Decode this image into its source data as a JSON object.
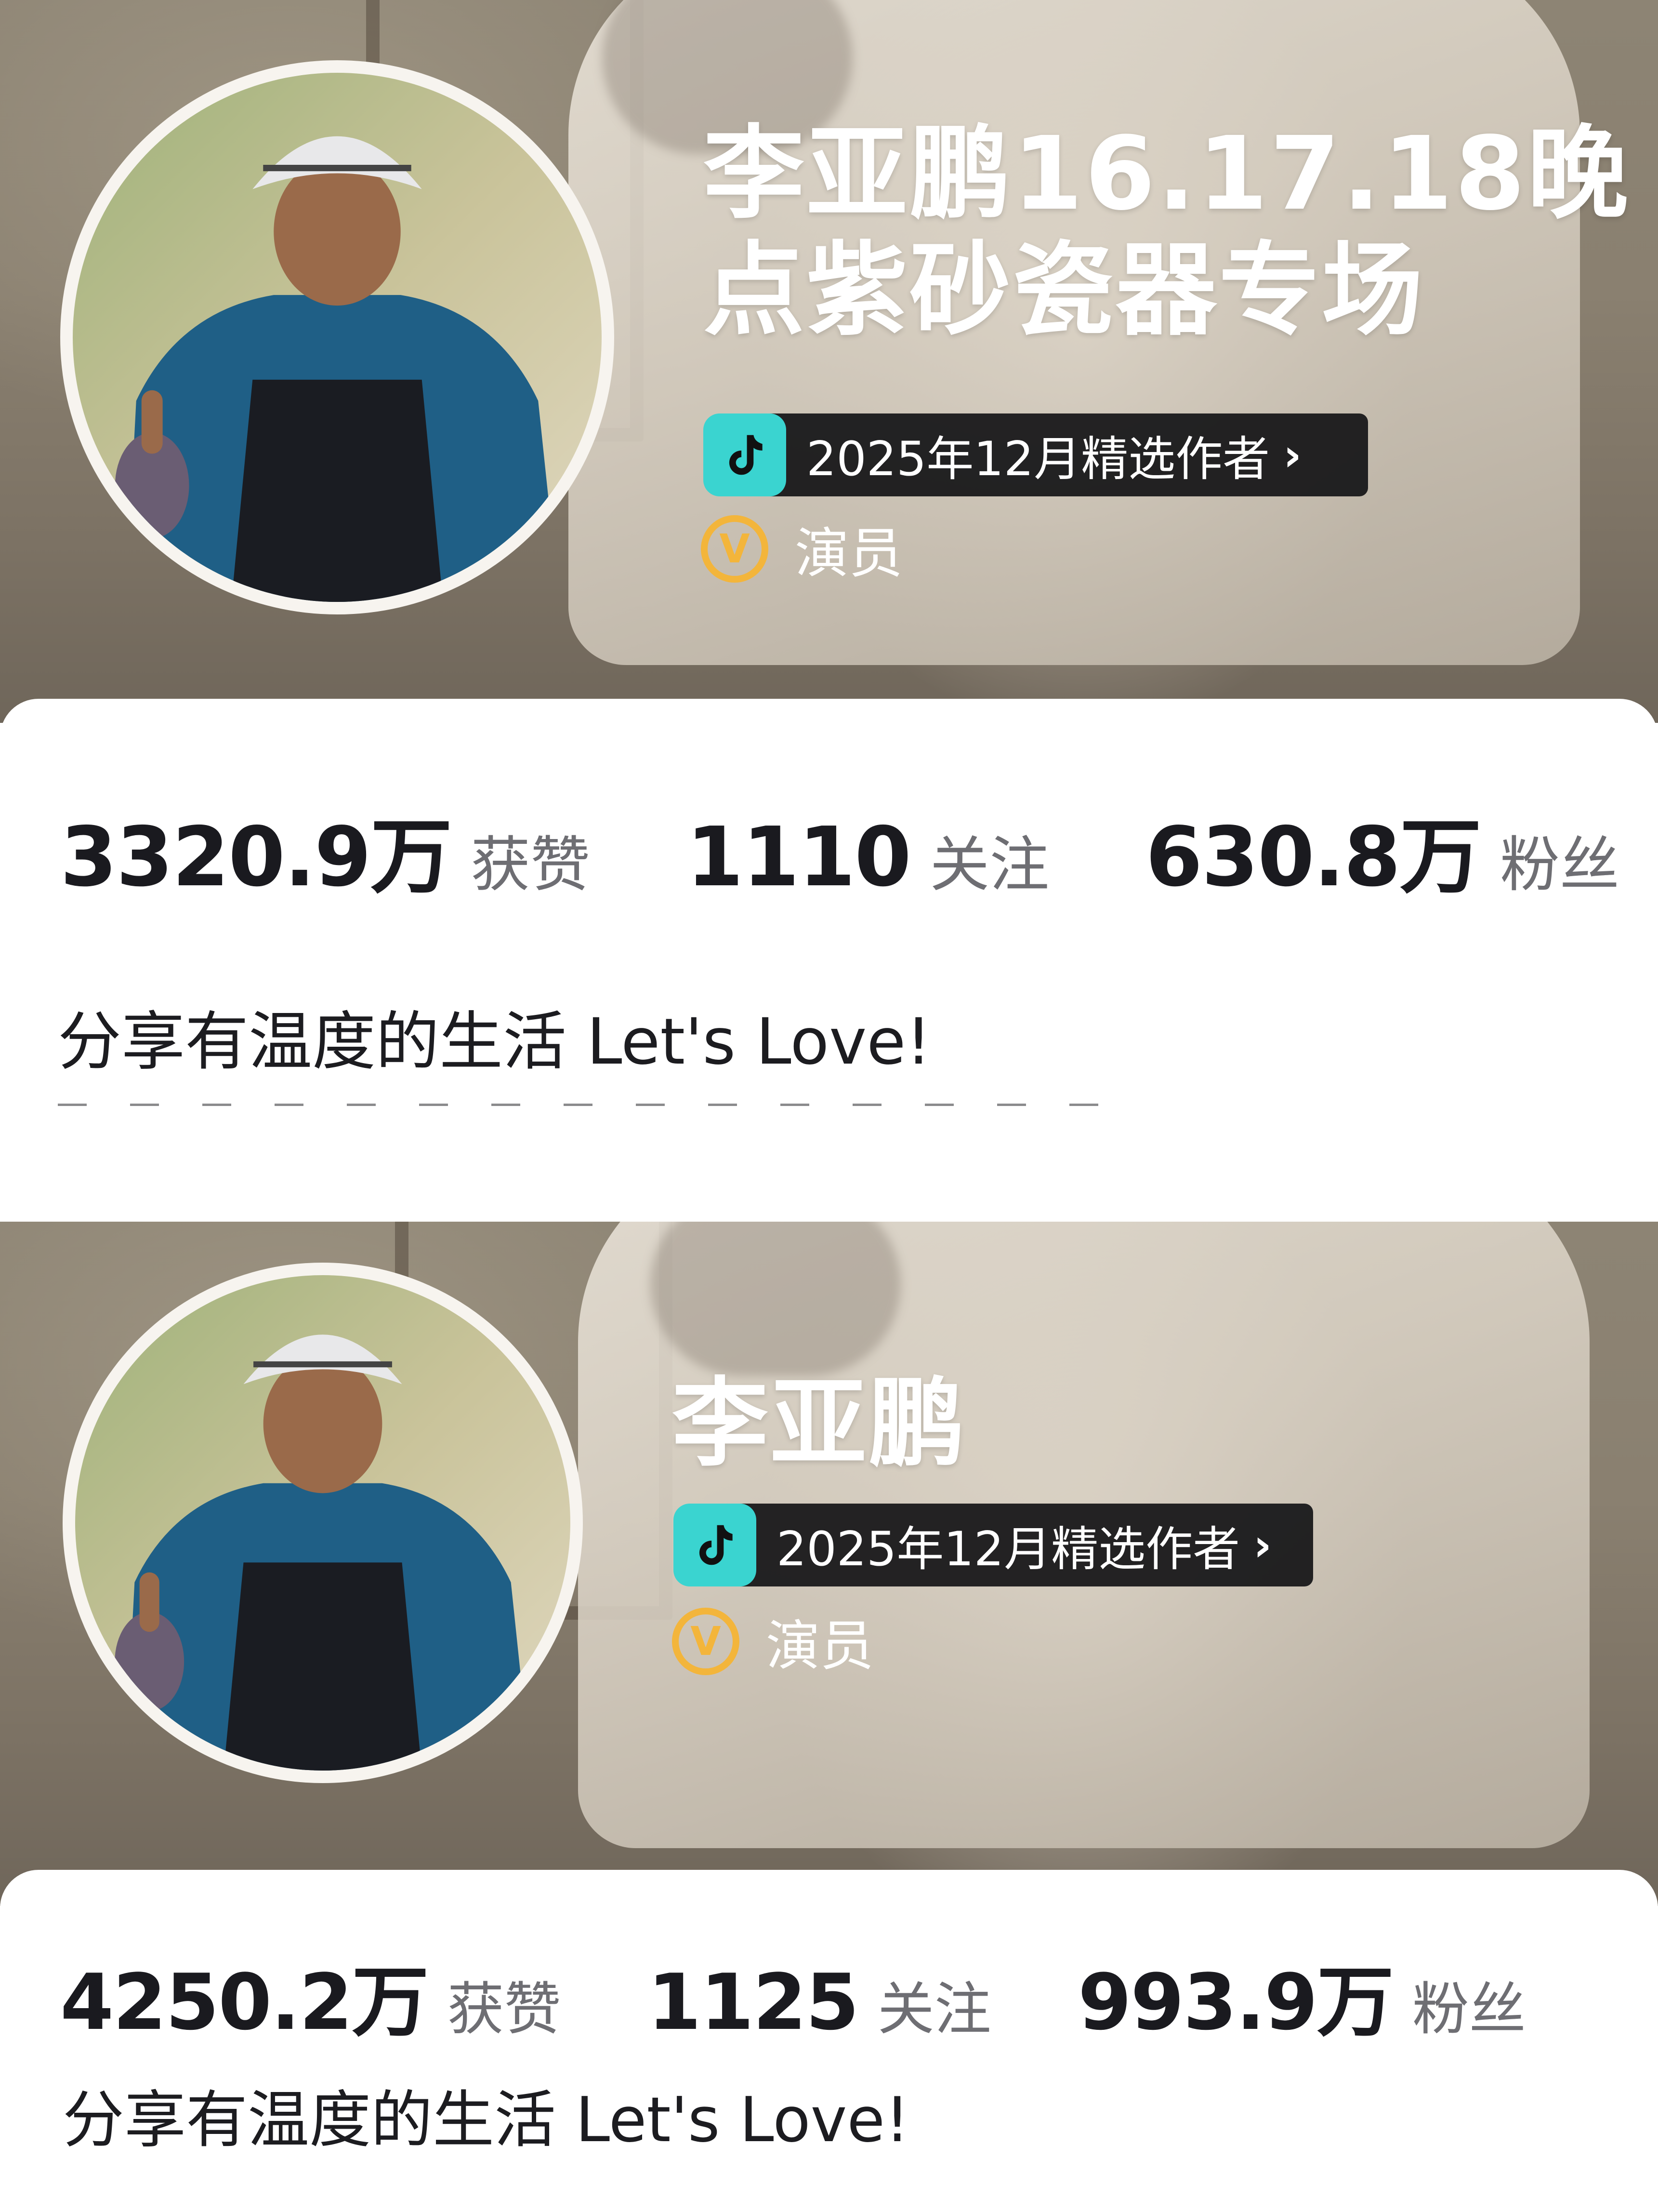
{
  "profiles": [
    {
      "title": "李亚鹏16.17.18晚\n点紫砂瓷器专场",
      "badge": {
        "icon": "tiktok-logo",
        "label": "2025年12月精选作者",
        "chevron": "›"
      },
      "role": {
        "icon_letter": "V",
        "label": "演员"
      },
      "stats": [
        {
          "value": "3320.9万",
          "label": "获赞"
        },
        {
          "value": "1110",
          "label": "关注"
        },
        {
          "value": "630.8万",
          "label": "粉丝"
        }
      ],
      "bio": "分享有温度的生活 Let's Love!"
    },
    {
      "title": "李亚鹏",
      "badge": {
        "icon": "tiktok-logo",
        "label": "2025年12月精选作者",
        "chevron": "›"
      },
      "role": {
        "icon_letter": "V",
        "label": "演员"
      },
      "stats": [
        {
          "value": "4250.2万",
          "label": "获赞"
        },
        {
          "value": "1125",
          "label": "关注"
        },
        {
          "value": "993.9万",
          "label": "粉丝"
        }
      ],
      "bio": "分享有温度的生活 Let's Love!"
    }
  ],
  "colors": {
    "badge_logo": "#3ad4d0",
    "verified": "#f3b53b",
    "stat_value": "#1a1a1f",
    "stat_label": "#6e6e73"
  }
}
